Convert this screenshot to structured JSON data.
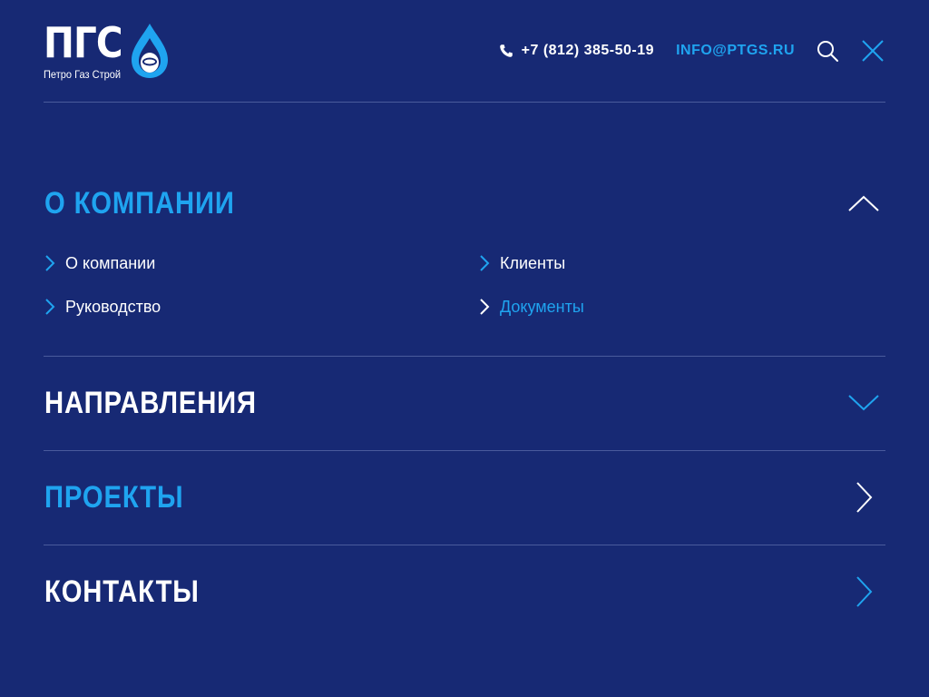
{
  "logo": {
    "mark": "ПГС",
    "subtitle": "Петро Газ Строй",
    "drop_icon": "gas-flame-drop-icon"
  },
  "header": {
    "phone": "+7 (812) 385-50-19",
    "phone_icon": "phone-icon",
    "email": "INFO@PTGS.RU",
    "search_icon": "search-icon",
    "close_icon": "close-icon"
  },
  "colors": {
    "background": "#172974",
    "accent": "#1fa4f0",
    "text": "#ffffff",
    "divider": "#4a5b9c"
  },
  "menu": {
    "sections": [
      {
        "title": "О КОМПАНИИ",
        "state": "expanded",
        "toggle_icon": "chevron-up-icon",
        "items": [
          {
            "label": "О компании"
          },
          {
            "label": "Клиенты"
          },
          {
            "label": "Руководство"
          },
          {
            "label": "Документы",
            "current": true
          }
        ]
      },
      {
        "title": "НАПРАВЛЕНИЯ",
        "state": "collapsed",
        "toggle_icon": "chevron-down-icon"
      },
      {
        "title": "ПРОЕКТЫ",
        "state": "link",
        "toggle_icon": "chevron-right-icon"
      },
      {
        "title": "КОНТАКТЫ",
        "state": "link",
        "toggle_icon": "chevron-right-icon"
      }
    ]
  }
}
